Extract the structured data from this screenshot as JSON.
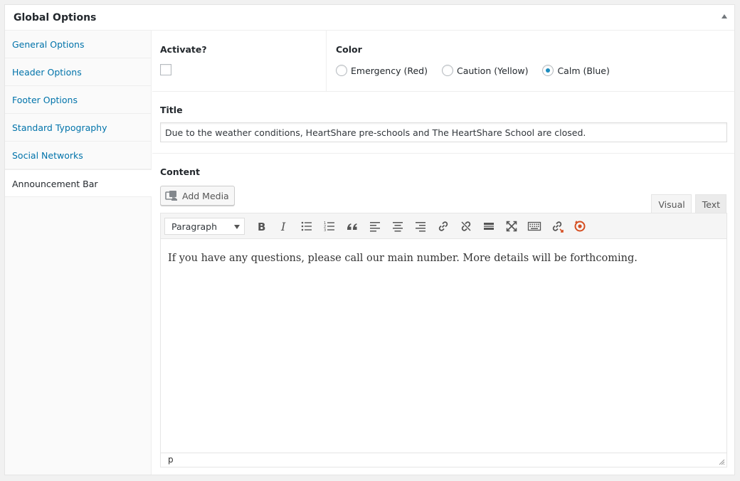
{
  "panel": {
    "title": "Global Options"
  },
  "sidebar": {
    "items": [
      {
        "label": "General Options"
      },
      {
        "label": "Header Options"
      },
      {
        "label": "Footer Options"
      },
      {
        "label": "Standard Typography"
      },
      {
        "label": "Social Networks"
      },
      {
        "label": "Announcement Bar"
      }
    ]
  },
  "activate": {
    "label": "Activate?",
    "checked": false
  },
  "color": {
    "label": "Color",
    "options": [
      {
        "label": "Emergency (Red)",
        "checked": false
      },
      {
        "label": "Caution (Yellow)",
        "checked": false
      },
      {
        "label": "Calm (Blue)",
        "checked": true
      }
    ],
    "accent": "#1e8cbe"
  },
  "title_field": {
    "label": "Title",
    "value": "Due to the weather conditions, HeartShare pre-schools and The HeartShare School are closed."
  },
  "content": {
    "label": "Content",
    "add_media_label": "Add Media",
    "tabs": {
      "visual": "Visual",
      "text": "Text"
    },
    "format_select": "Paragraph",
    "body": "If you have any questions, please call our main number. More details will be forthcoming.",
    "path": "p",
    "toolbar_icons": [
      "bold-icon",
      "italic-icon",
      "bulleted-list-icon",
      "numbered-list-icon",
      "blockquote-icon",
      "align-left-icon",
      "align-center-icon",
      "align-right-icon",
      "link-icon",
      "unlink-icon",
      "read-more-icon",
      "fullscreen-icon",
      "toolbar-toggle-icon",
      "link-check-icon",
      "plugin-icon"
    ]
  },
  "colors": {
    "link": "#0073aa",
    "border": "#e5e5e5",
    "plugin": "#d54e21"
  }
}
